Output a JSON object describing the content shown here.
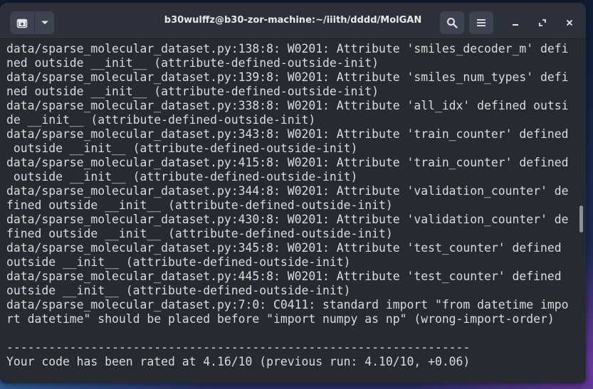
{
  "window": {
    "title": "b30wulffz@b30-zor-machine:~/iiith/dddd/MolGAN"
  },
  "headerbar": {
    "new_tab_icon": "new-tab-icon",
    "dropdown_icon": "chevron-down-icon",
    "search_icon": "search-icon",
    "menu_icon": "hamburger-icon",
    "minimize_icon": "minimize-icon",
    "maximize_icon": "maximize-icon",
    "close_icon": "close-icon"
  },
  "terminal": {
    "lines": [
      "data/sparse_molecular_dataset.py:138:8: W0201: Attribute 'smiles_decoder_m' defi",
      "ned outside __init__ (attribute-defined-outside-init)",
      "data/sparse_molecular_dataset.py:139:8: W0201: Attribute 'smiles_num_types' defi",
      "ned outside __init__ (attribute-defined-outside-init)",
      "data/sparse_molecular_dataset.py:338:8: W0201: Attribute 'all_idx' defined outsi",
      "de __init__ (attribute-defined-outside-init)",
      "data/sparse_molecular_dataset.py:343:8: W0201: Attribute 'train_counter' defined",
      " outside __init__ (attribute-defined-outside-init)",
      "data/sparse_molecular_dataset.py:415:8: W0201: Attribute 'train_counter' defined",
      " outside __init__ (attribute-defined-outside-init)",
      "data/sparse_molecular_dataset.py:344:8: W0201: Attribute 'validation_counter' de",
      "fined outside __init__ (attribute-defined-outside-init)",
      "data/sparse_molecular_dataset.py:430:8: W0201: Attribute 'validation_counter' de",
      "fined outside __init__ (attribute-defined-outside-init)",
      "data/sparse_molecular_dataset.py:345:8: W0201: Attribute 'test_counter' defined",
      "outside __init__ (attribute-defined-outside-init)",
      "data/sparse_molecular_dataset.py:445:8: W0201: Attribute 'test_counter' defined",
      "outside __init__ (attribute-defined-outside-init)",
      "data/sparse_molecular_dataset.py:7:0: C0411: standard import \"from datetime impo",
      "rt datetime\" should be placed before \"import numpy as np\" (wrong-import-order)",
      "",
      "------------------------------------------------------------------",
      "Your code has been rated at 4.16/10 (previous run: 4.10/10, +0.06)",
      ""
    ]
  }
}
